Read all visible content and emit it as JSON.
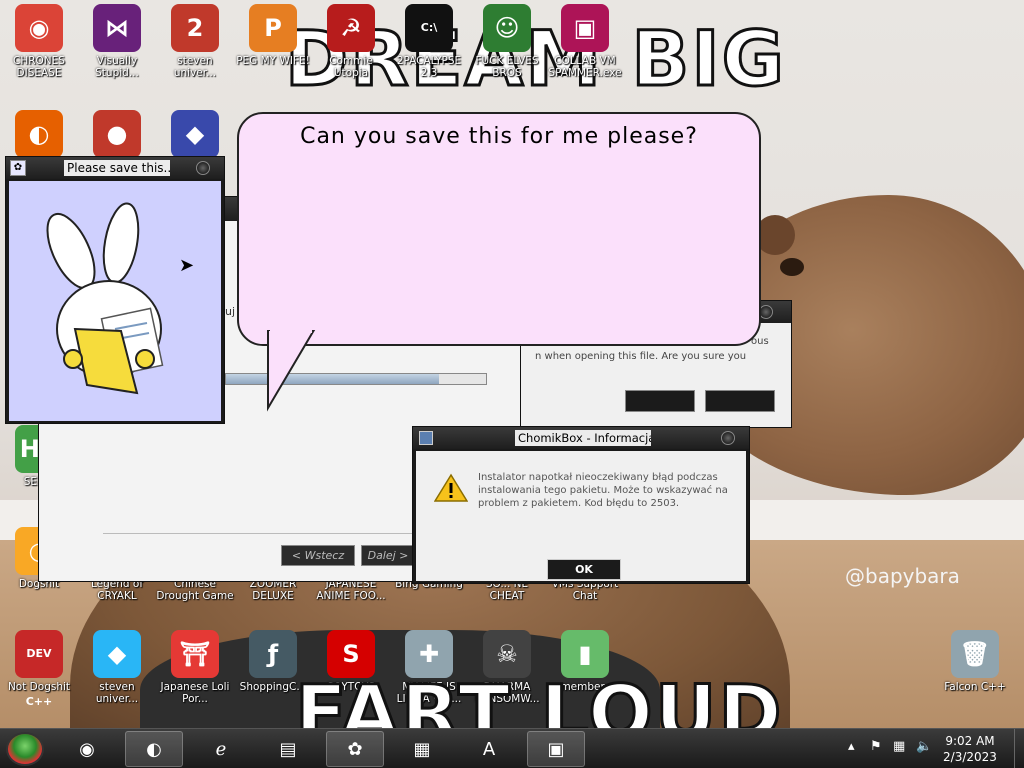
{
  "wallpaper": {
    "top_text": "DREAM BIG",
    "bottom_text": "FART LOUD",
    "watermark": "@bapybara"
  },
  "desktop_icons": [
    {
      "label": "CHRONES DISEASE",
      "icon": "chrome-icon",
      "color": "#db4437",
      "glyph": "◉"
    },
    {
      "label": "Visually Stupid...",
      "icon": "visual-studio-icon",
      "color": "#68217a",
      "glyph": "⋈"
    },
    {
      "label": "steven univer...",
      "icon": "steven-universe-icon",
      "color": "#c0392b",
      "glyph": "2"
    },
    {
      "label": "PEG MY WIFE!",
      "icon": "peggle-icon",
      "color": "#e67e22",
      "glyph": "P"
    },
    {
      "label": "Commie Utopia",
      "icon": "commie-icon",
      "color": "#b71c1c",
      "glyph": "☭"
    },
    {
      "label": "2PACALYPSE 2.3",
      "icon": "cmd-icon",
      "color": "#111111",
      "glyph": "C:\\"
    },
    {
      "label": "FUCK ELVES BROS",
      "icon": "elf-icon",
      "color": "#2e7d32",
      "glyph": "☺"
    },
    {
      "label": "COLLAB VM SPAMMER.exe",
      "icon": "spammer-icon",
      "color": "#ad1457",
      "glyph": "▣"
    },
    {
      "label": "",
      "icon": "firefox-icon",
      "color": "#e66000",
      "glyph": "◐"
    },
    {
      "label": "",
      "icon": "angry-birds-icon",
      "color": "#c0392b",
      "glyph": "●"
    },
    {
      "label": "",
      "icon": "bejeweled-icon",
      "color": "#3949ab",
      "glyph": "◆"
    },
    {
      "label": "SEX E",
      "icon": "hx-icon",
      "color": "#43a047",
      "glyph": "HX"
    },
    {
      "label": "Dogshit",
      "icon": "dogshit-icon",
      "color": "#f9a825",
      "glyph": "◑"
    },
    {
      "label": "Legend of CRYAKL",
      "icon": "cryakl-icon",
      "color": "#6d4c41",
      "glyph": ""
    },
    {
      "label": "Chinese Drought Game",
      "icon": "drought-icon",
      "color": "#8d6e63",
      "glyph": ""
    },
    {
      "label": "ZOOMER DELUXE",
      "icon": "zoomer-icon",
      "color": "#795548",
      "glyph": ""
    },
    {
      "label": "JAPANESE ANIME FOO...",
      "icon": "anime-icon",
      "color": "#795548",
      "glyph": ""
    },
    {
      "label": "Bing Gaming",
      "icon": "bing-icon",
      "color": "#795548",
      "glyph": ""
    },
    {
      "label": "SO... NE CHEAT",
      "icon": "cheat-icon",
      "color": "#795548",
      "glyph": ""
    },
    {
      "label": "VMs Support Chat",
      "icon": "support-icon",
      "color": "#795548",
      "glyph": ""
    },
    {
      "label": "Not Dogshit",
      "icon": "devcpp-icon",
      "color": "#c62828",
      "glyph": "DEV C++"
    },
    {
      "label": "steven univer...",
      "icon": "diamond-icon",
      "color": "#29b6f6",
      "glyph": "◆"
    },
    {
      "label": "Japanese Loli Por...",
      "icon": "torii-icon",
      "color": "#e53935",
      "glyph": "⛩"
    },
    {
      "label": "ShoppingC...",
      "icon": "flash-icon",
      "color": "#455a64",
      "glyph": "ƒ"
    },
    {
      "label": "SOYTOYS",
      "icon": "soytoys-icon",
      "color": "#d50000",
      "glyph": "S"
    },
    {
      "label": "MY LIFE IS LIKE A VID...",
      "icon": "gamepad-icon",
      "color": "#90a4ae",
      "glyph": "✚"
    },
    {
      "label": "DHARMA RANSOMW...",
      "icon": "dharma-icon",
      "color": "#424242",
      "glyph": "☠"
    },
    {
      "label": "remember_...",
      "icon": "notepad-icon",
      "color": "#66bb6a",
      "glyph": "▮"
    },
    {
      "label": "Falcon C++",
      "icon": "recycle-bin-icon",
      "color": "#90a4ae",
      "glyph": "🗑"
    }
  ],
  "bubble": {
    "text": "Can you save this for me please?"
  },
  "bunny_window": {
    "title": "Please save this...",
    "bg": "#cfd0fe"
  },
  "installer_window": {
    "title": "",
    "text_fragment": "uj",
    "back_button": "< Wstecz",
    "next_button": "Dalej >",
    "progress": 0.82
  },
  "warning_window": {
    "text_fragment_1": "ous",
    "text_fragment_2": "n when opening this file. Are you sure you"
  },
  "chomik_dialog": {
    "title": "ChomikBox - Informacja",
    "message": "Instalator napotkał nieoczekiwany błąd podczas instalowania tego pakietu. Może to wskazywać na problem z pakietem. Kod błędu to 2503.",
    "ok_button": "OK"
  },
  "taskbar": {
    "start_icon": "start-orb-icon",
    "buttons": [
      {
        "icon": "chrome-icon",
        "glyph": "◉",
        "active": false
      },
      {
        "icon": "firefox-icon",
        "glyph": "◐",
        "active": true
      },
      {
        "icon": "ie-icon",
        "glyph": "ℯ",
        "active": false
      },
      {
        "icon": "explorer-icon",
        "glyph": "▤",
        "active": false
      },
      {
        "icon": "bunny-icon",
        "glyph": "✿",
        "active": true
      },
      {
        "icon": "winrar-icon",
        "glyph": "▦",
        "active": false
      },
      {
        "icon": "wordpad-icon",
        "glyph": "A",
        "active": false
      },
      {
        "icon": "installer-icon",
        "glyph": "▣",
        "active": true
      }
    ],
    "clock_time": "9:02 AM",
    "clock_date": "2/3/2023"
  }
}
